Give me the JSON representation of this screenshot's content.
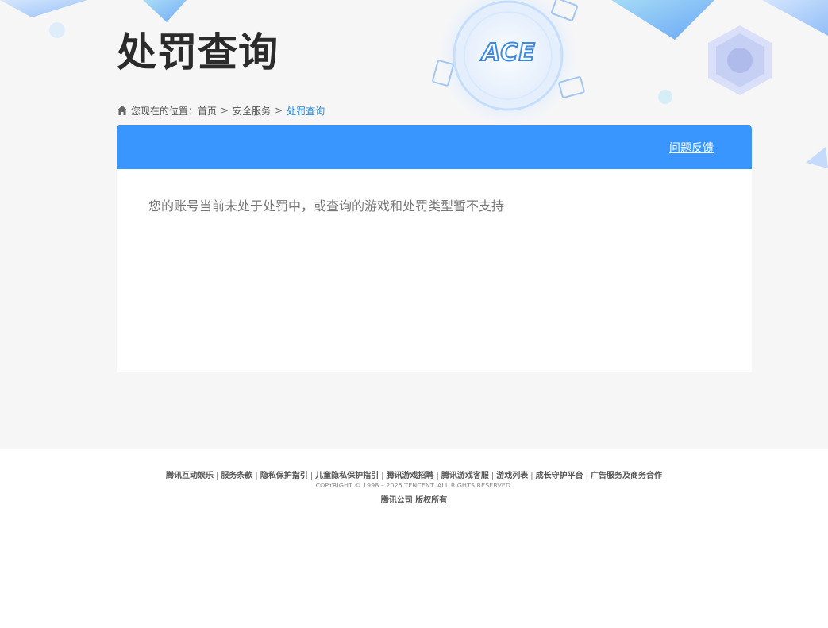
{
  "page": {
    "title": "处罚查询"
  },
  "breadcrumb": {
    "prefix": "您现在的位置：",
    "items": [
      {
        "label": "首页"
      },
      {
        "label": "安全服务"
      },
      {
        "label": "处罚查询"
      }
    ],
    "separator": ">"
  },
  "panel": {
    "feedback_label": "问题反馈",
    "message": "您的账号当前未处于处罚中，或查询的游戏和处罚类型暂不支持"
  },
  "logo": {
    "text": "ACE"
  },
  "footer": {
    "links": [
      {
        "label": "腾讯互动娱乐"
      },
      {
        "label": "服务条款"
      },
      {
        "label": "隐私保护指引"
      },
      {
        "label": "儿童隐私保护指引"
      },
      {
        "label": "腾讯游戏招聘"
      },
      {
        "label": "腾讯游戏客服"
      },
      {
        "label": "游戏列表"
      },
      {
        "label": "成长守护平台"
      },
      {
        "label": "广告服务及商务合作"
      }
    ],
    "divider": "|",
    "copyright": "COPYRIGHT © 1998 – 2025 TENCENT. ALL RIGHTS RESERVED.",
    "company": "腾讯公司 版权所有"
  },
  "colors": {
    "accent": "#3a96ff",
    "link_current": "#1f8ae0",
    "background": "#f6f6f7"
  }
}
